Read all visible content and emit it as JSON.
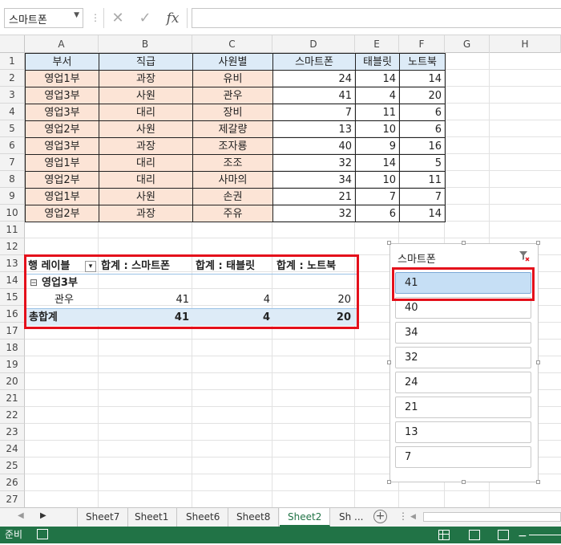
{
  "namebox": {
    "value": "스마트폰"
  },
  "formula": {
    "value": ""
  },
  "columns": [
    "A",
    "B",
    "C",
    "D",
    "E",
    "F",
    "G",
    "H"
  ],
  "rows": [
    "1",
    "2",
    "3",
    "4",
    "5",
    "6",
    "7",
    "8",
    "9",
    "10",
    "11",
    "12",
    "13",
    "14",
    "15",
    "16",
    "17",
    "18",
    "19",
    "20",
    "21",
    "22",
    "23",
    "24",
    "25",
    "26",
    "27"
  ],
  "table": {
    "headers": [
      "부서",
      "직급",
      "사원별",
      "스마트폰",
      "태블릿",
      "노트북"
    ],
    "rows": [
      [
        "영업1부",
        "과장",
        "유비",
        "24",
        "14",
        "14"
      ],
      [
        "영업3부",
        "사원",
        "관우",
        "41",
        "4",
        "20"
      ],
      [
        "영업3부",
        "대리",
        "장비",
        "7",
        "11",
        "6"
      ],
      [
        "영업2부",
        "사원",
        "제갈량",
        "13",
        "10",
        "6"
      ],
      [
        "영업3부",
        "과장",
        "조자룡",
        "40",
        "9",
        "16"
      ],
      [
        "영업1부",
        "대리",
        "조조",
        "32",
        "14",
        "5"
      ],
      [
        "영업2부",
        "대리",
        "사마의",
        "34",
        "10",
        "11"
      ],
      [
        "영업1부",
        "사원",
        "손권",
        "21",
        "7",
        "7"
      ],
      [
        "영업2부",
        "과장",
        "주유",
        "32",
        "6",
        "14"
      ]
    ]
  },
  "pivot": {
    "row_label": "행 레이블",
    "headers": [
      "합계 : 스마트폰",
      "합계 : 태블릿",
      "합계 : 노트북"
    ],
    "group": "영업3부",
    "group_toggle": "⊟",
    "item": {
      "name": "관우",
      "values": [
        "41",
        "4",
        "20"
      ]
    },
    "total": {
      "label": "총합계",
      "values": [
        "41",
        "4",
        "20"
      ]
    }
  },
  "slicer": {
    "title": "스마트폰",
    "items": [
      "41",
      "40",
      "34",
      "32",
      "24",
      "21",
      "13",
      "7"
    ],
    "selected_index": 0
  },
  "sheet_tabs": [
    "Sheet7",
    "Sheet1",
    "Sheet6",
    "Sheet8",
    "Sheet2",
    "Sh ..."
  ],
  "active_tab": "Sheet2",
  "status": {
    "ready": "준비"
  },
  "colors": {
    "accent": "#217346",
    "highlight": "#e4101b",
    "header_fill": "#ddebf7",
    "pink_fill": "#fce4d6"
  }
}
